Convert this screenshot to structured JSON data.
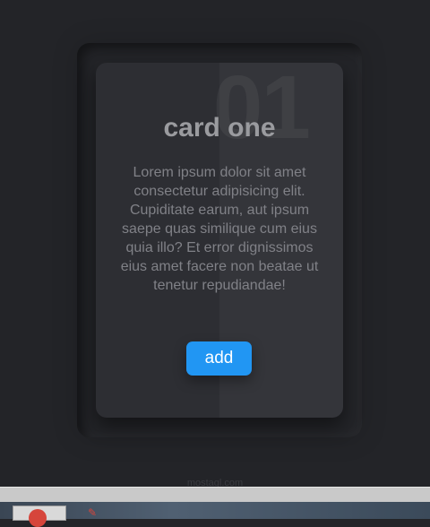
{
  "card": {
    "number": "01",
    "title": "card one",
    "body": "Lorem ipsum dolor sit amet consectetur adipisicing elit. Cupiditate earum, aut ipsum saepe quas similique cum eius quia illo? Et error dignissimos eius amet facere non beatae ut tenetur repudiandae!",
    "button_label": "add"
  },
  "watermark": "mostaql.com",
  "colors": {
    "background": "#232428",
    "card": "#2d2e33",
    "accent": "#2196f3"
  }
}
